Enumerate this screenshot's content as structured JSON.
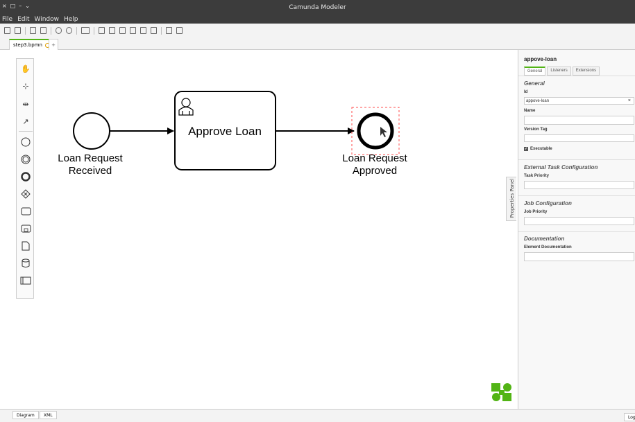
{
  "window": {
    "title": "Camunda Modeler",
    "controls": [
      "×",
      "□",
      "–",
      "⌄"
    ]
  },
  "menu": [
    "File",
    "Edit",
    "Window",
    "Help"
  ],
  "file_tab": {
    "name": "step3.bpmn",
    "add_label": "+"
  },
  "diagram": {
    "start_event_label": [
      "Loan Request",
      "Received"
    ],
    "task_label": "Approve Loan",
    "end_event_label": [
      "Loan Request",
      "Approved"
    ]
  },
  "properties_toggle_label": "Properties Panel",
  "properties": {
    "element_id_title": "appove-loan",
    "tabs": [
      "General",
      "Listeners",
      "Extensions"
    ],
    "general_group": "General",
    "id_label": "Id",
    "id_value": "appove-loan",
    "clear_symbol": "×",
    "name_label": "Name",
    "name_value": "",
    "version_tag_label": "Version Tag",
    "version_tag_value": "",
    "executable_label": "Executable",
    "external_task_group": "External Task Configuration",
    "task_priority_label": "Task Priority",
    "job_config_group": "Job Configuration",
    "job_priority_label": "Job Priority",
    "documentation_group": "Documentation",
    "element_doc_label": "Element Documentation"
  },
  "bottom_tabs": [
    "Diagram",
    "XML"
  ],
  "log_label": "Log",
  "colors": {
    "accent": "#52b415",
    "titlebar": "#3c3c3c",
    "selection": "#ff4d4d"
  }
}
